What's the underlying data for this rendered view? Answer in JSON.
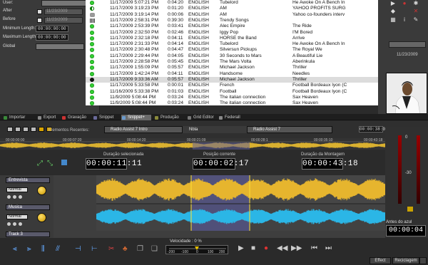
{
  "filter_panel": {
    "user_label": "User:",
    "after_label": "After",
    "after_value": "11/23/2009",
    "before_label": "Before",
    "before_value": "11/23/2009",
    "min_length_label": "Minimum Length:",
    "min_length_value": "00:00:00:00",
    "max_length_label": "Maximum Length:",
    "max_length_value": "00:00:00:00",
    "global_label": "Global"
  },
  "table": {
    "rows": [
      {
        "icon": "green",
        "date": "11/17/2009 5:07:21 PM",
        "dur": "0:04:20",
        "lang": "ENGLISH",
        "artist": "Tubelord",
        "title": "He Awoke On A Bench In"
      },
      {
        "icon": "half",
        "date": "11/17/2009 3:19:23 PM",
        "dur": "0:01:20",
        "lang": "ENGLISH",
        "artist": "AM",
        "title": "YAHOO PROFITS SURG"
      },
      {
        "icon": "mic",
        "date": "11/17/2009 3:19:14 PM",
        "dur": "0:00:06",
        "lang": "ENGLISH",
        "artist": "AM",
        "title": "Yahoo co-founders interv"
      },
      {
        "icon": "film",
        "date": "11/17/2009 2:58:31 PM",
        "dur": "0:39:30",
        "lang": "ENGLISH",
        "artist": "Trendy Songs",
        "title": ""
      },
      {
        "icon": "green",
        "date": "11/17/2009 2:53:39 PM",
        "dur": "0:03:41",
        "lang": "ENGLISH",
        "artist": "Alec Empire",
        "title": "The Ride"
      },
      {
        "icon": "green",
        "date": "11/17/2009 2:32:50 PM",
        "dur": "0:02:46",
        "lang": "ENGLISH",
        "artist": "Iggy Pop",
        "title": "I'M Bored"
      },
      {
        "icon": "green",
        "date": "11/17/2009 2:32:18 PM",
        "dur": "0:04:11",
        "lang": "ENGLISH",
        "artist": "HORSE the Band",
        "title": "Arrive"
      },
      {
        "icon": "green",
        "date": "11/17/2009 2:31:33 PM",
        "dur": "0:04:14",
        "lang": "ENGLISH",
        "artist": "Tubelord",
        "title": "He Awoke On A Bench In"
      },
      {
        "icon": "green",
        "date": "11/17/2009 2:30:48 PM",
        "dur": "0:04:47",
        "lang": "ENGLISH",
        "artist": "Silversun Pickups",
        "title": "The Royal We"
      },
      {
        "icon": "green",
        "date": "11/17/2009 2:29:44 PM",
        "dur": "0:04:05",
        "lang": "ENGLISH",
        "artist": "30 Seconds to Mars",
        "title": "A Beautiful Lie"
      },
      {
        "icon": "green",
        "date": "11/17/2009 2:28:58 PM",
        "dur": "0:05:45",
        "lang": "ENGLISH",
        "artist": "The Mars Volta",
        "title": "Aberinkula"
      },
      {
        "icon": "green",
        "date": "11/17/2009 1:55:09 PM",
        "dur": "0:05:57",
        "lang": "ENGLISH",
        "artist": "Michael Jackson",
        "title": "Thriller"
      },
      {
        "icon": "green",
        "date": "11/17/2009 1:42:24 PM",
        "dur": "0:04:11",
        "lang": "ENGLISH",
        "artist": "Handsome",
        "title": "Needles"
      },
      {
        "icon": "blk",
        "date": "11/17/2009 9:33:36 AM",
        "dur": "0:05:57",
        "lang": "ENGLISH",
        "artist": "Michael Jackson",
        "title": "Thriller",
        "selected": true
      },
      {
        "icon": "green",
        "date": "11/17/2009 5:33:58 PM",
        "dur": "0:00:01",
        "lang": "ENGLISH",
        "artist": "French",
        "title": "Football Bordeaux lyon (C"
      },
      {
        "icon": "green",
        "date": "11/16/2009 5:33:38 PM",
        "dur": "0:01:03",
        "lang": "ENGLISH",
        "artist": "Football",
        "title": "Football Bordeaux lyon (C"
      },
      {
        "icon": "green",
        "date": "11/9/2009 5:08:44 PM",
        "dur": "0:03:24",
        "lang": "ENGLISH",
        "artist": "The italian connection",
        "title": "Sax Heaven"
      },
      {
        "icon": "green",
        "date": "11/9/2009 5:08:44 PM",
        "dur": "0:03:24",
        "lang": "ENGLISH",
        "artist": "The italian connection",
        "title": "Sax Heaven"
      }
    ]
  },
  "right_panel": {
    "date": "11/23/2009"
  },
  "tabs": [
    {
      "label": "Importar",
      "color": "#3a8a3a"
    },
    {
      "label": "Export",
      "color": "#8a8a8a"
    },
    {
      "label": "Gravação",
      "color": "#c33"
    },
    {
      "label": "Snippet",
      "color": "#6a6a9a"
    },
    {
      "label": "Snippet+",
      "color": "#6a9acc",
      "active": true
    },
    {
      "label": "Produção",
      "color": "#8a8a3a"
    },
    {
      "label": "Grid Editor",
      "color": "#777"
    },
    {
      "label": "Federall",
      "color": "#888"
    }
  ],
  "editor": {
    "recent_label": "Elementos Recentes:",
    "item1": "Radio Assist 7 Intro",
    "item2": "Nbla",
    "item3": "Radio Assist 7",
    "top_counter": "00:00:38:04"
  },
  "ruler_ticks": [
    "00:00:00:00",
    "00:00:07:20",
    "00:00:14:20",
    "00:00:21:09",
    "00:00:28:1",
    "00:00:35:10",
    "00:00:43:18"
  ],
  "counters": [
    {
      "label": "Duração selecionada",
      "value": "00:00:11:11"
    },
    {
      "label": "Posição corrente",
      "value": "00:00:02:17"
    },
    {
      "label": "Duração da Montagem",
      "value": "00:00:43:18"
    }
  ],
  "tracks": [
    {
      "name": "Entrevista",
      "mode": "Normal",
      "color": "#e6b52e"
    },
    {
      "name": "Musica",
      "mode": "Normal",
      "color": "#2bb6e6"
    },
    {
      "name": "Track 3",
      "mode": "",
      "color": "#777"
    }
  ],
  "vu": {
    "scale_top": "0",
    "scale_mid": "-30",
    "tail_label": "Antes do azul",
    "tail_value": "00:00:04"
  },
  "transport": {
    "speed_label": "Velocidade : 0 %",
    "speed_ticks": [
      "-200",
      "-100",
      "0",
      "100",
      "200"
    ],
    "effect_label": "Effect",
    "recycle_label": "Reciclagem"
  }
}
